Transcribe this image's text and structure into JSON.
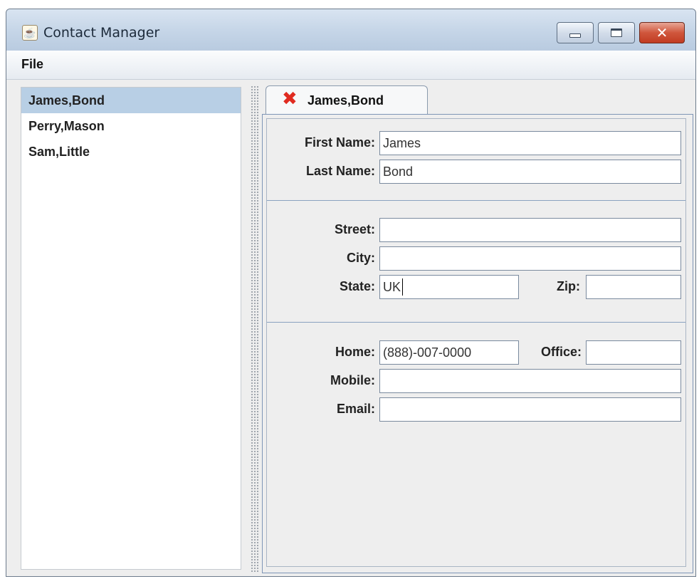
{
  "window": {
    "title": "Contact Manager",
    "icon": "java-icon",
    "buttons": [
      "minimize",
      "maximize",
      "close"
    ],
    "close_glyph": "✕"
  },
  "menu": {
    "file_label": "File"
  },
  "contacts": [
    "James,Bond",
    "Perry,Mason",
    "Sam,Little"
  ],
  "selected_index": 0,
  "tab": {
    "label": "James,Bond",
    "close_glyph": "✖",
    "close_color": "#e02b20"
  },
  "form": {
    "first_name_label": "First Name:",
    "first_name_value": "James",
    "last_name_label": "Last Name:",
    "last_name_value": "Bond",
    "street_label": "Street:",
    "street_value": "",
    "city_label": "City:",
    "city_value": "",
    "state_label": "State:",
    "state_value": "UK",
    "zip_label": "Zip:",
    "zip_value": "",
    "home_label": "Home:",
    "home_value": "(888)-007-0000",
    "office_label": "Office:",
    "office_value": "",
    "mobile_label": "Mobile:",
    "mobile_value": "",
    "email_label": "Email:",
    "email_value": ""
  },
  "colors": {
    "selection": "#b8cfe5",
    "window_frame": "#c4d3e5",
    "close_button": "#c23c22"
  }
}
